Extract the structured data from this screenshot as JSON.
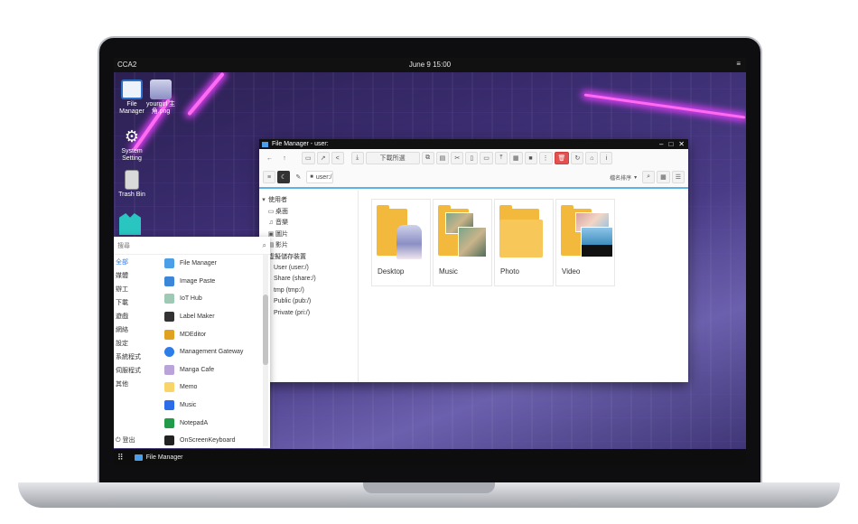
{
  "topbar": {
    "os_label": "CCA2",
    "clock": "June 9 15:00",
    "menu_icon": "hamburger-icon"
  },
  "desktop_icons": [
    {
      "label": "File Manager",
      "icon": "folder-icon"
    },
    {
      "label": "yourgirl 主角.png",
      "icon": "image-file-icon"
    },
    {
      "label": "System Setting",
      "icon": "gear-icon"
    },
    {
      "label": "Trash Bin",
      "icon": "trash-icon"
    }
  ],
  "file_manager": {
    "title": "File Manager - user:",
    "toolbar": {
      "download_label": "下載所選"
    },
    "path": "user:/",
    "sort_label": "檔名排序",
    "sidebar": [
      {
        "label": "使用者",
        "icon": "caret-down-icon"
      },
      {
        "label": "桌面",
        "icon": "monitor-icon"
      },
      {
        "label": "音樂",
        "icon": "music-icon"
      },
      {
        "label": "圖片",
        "icon": "image-icon"
      },
      {
        "label": "影片",
        "icon": "film-icon"
      },
      {
        "label": "虛擬儲存裝置",
        "icon": "caret-down-icon"
      },
      {
        "label": "User (user:/)",
        "icon": ""
      },
      {
        "label": "Share (share:/)",
        "icon": ""
      },
      {
        "label": "tmp (tmp:/)",
        "icon": ""
      },
      {
        "label": "Public (pub:/)",
        "icon": ""
      },
      {
        "label": "Private (pri:/)",
        "icon": ""
      }
    ],
    "folders": [
      {
        "name": "Desktop"
      },
      {
        "name": "Music"
      },
      {
        "name": "Photo"
      },
      {
        "name": "Video"
      }
    ]
  },
  "start_menu": {
    "search_placeholder": "搜尋",
    "categories": [
      "全部",
      "媒體",
      "辦工",
      "下載",
      "遊戲",
      "網絡",
      "設定",
      "系統程式",
      "伺服程式",
      "其他"
    ],
    "logout_label": "登出",
    "apps": [
      {
        "name": "File Manager",
        "color": "#4a9fe8"
      },
      {
        "name": "Image Paste",
        "color": "#3b86d9"
      },
      {
        "name": "IoT Hub",
        "color": "#9ec9b5"
      },
      {
        "name": "Label Maker",
        "color": "#333333"
      },
      {
        "name": "MDEditor",
        "color": "#e0a020"
      },
      {
        "name": "Management Gateway",
        "color": "#2b7de9"
      },
      {
        "name": "Manga Cafe",
        "color": "#b9a3d8"
      },
      {
        "name": "Memo",
        "color": "#f7d56b"
      },
      {
        "name": "Music",
        "color": "#2b6de9"
      },
      {
        "name": "NotepadA",
        "color": "#1f9b4a"
      },
      {
        "name": "OnScreenKeyboard",
        "color": "#222222"
      }
    ]
  },
  "taskbar": {
    "grid_icon": "app-grid-icon",
    "task_label": "File Manager"
  }
}
